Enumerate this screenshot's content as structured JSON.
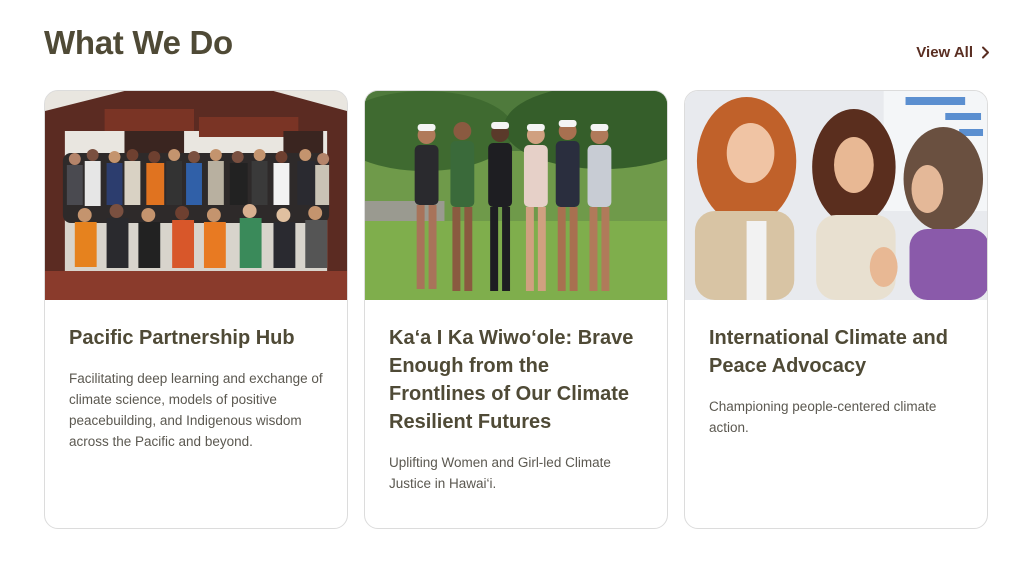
{
  "section": {
    "title": "What We Do",
    "view_all_label": "View All",
    "view_all_icon": "chevron-right-icon"
  },
  "colors": {
    "title": "#4f4a36",
    "link": "#5a2e22",
    "body_text": "#5b5850",
    "card_border": "#dcdcdc"
  },
  "cards": [
    {
      "image_alt": "Group of people posing in front of a carved meeting house",
      "title": "Pacific Partnership Hub",
      "description": "Facilitating deep learning and exchange of climate science, models of positive peacebuilding, and Indigenous wisdom across the Pacific and beyond."
    },
    {
      "image_alt": "Young women standing together on grass in a green valley",
      "title": "Ka‘a I Ka Wiwo‘ole: Brave Enough from the Frontlines of Our Climate Resilient Futures",
      "description": "Uplifting Women and Girl-led Climate Justice in Hawai‘i."
    },
    {
      "image_alt": "Three women in conversation at a conference",
      "title": "International Climate and Peace Advocacy",
      "description": "Championing people-centered climate action."
    }
  ]
}
